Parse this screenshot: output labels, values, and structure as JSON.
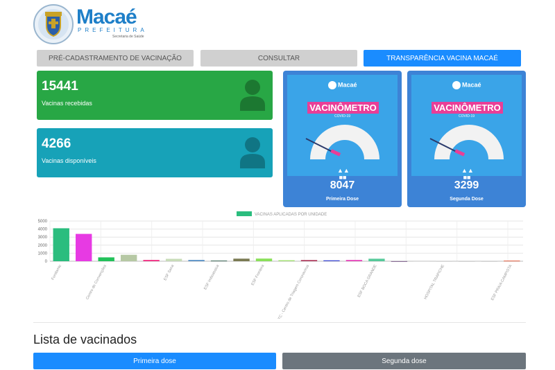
{
  "brand": {
    "name": "Macaé",
    "subtitle": "PREFEITURA",
    "department": "Secretaria de Saúde"
  },
  "tabs": [
    {
      "label": "PRÉ-CADASTRAMENTO DE VACINAÇÃO",
      "active": false
    },
    {
      "label": "CONSULTAR",
      "active": false
    },
    {
      "label": "TRANSPARÊNCIA VACINA MACAÉ",
      "active": true
    }
  ],
  "stats": [
    {
      "value": "15441",
      "label": "Vacinas recebidas",
      "color": "#28a745",
      "icon": "person-icon"
    },
    {
      "value": "4266",
      "label": "Vacinas disponíveis",
      "color": "#17a2b8",
      "icon": "person-icon"
    }
  ],
  "vaccinometers": [
    {
      "logo_text": "Macaé",
      "badge": "VACINÔMETRO",
      "sub": "COVID-19",
      "count": "8047",
      "dose": "Primeira Dose",
      "icon": "people-icon"
    },
    {
      "logo_text": "Macaé",
      "badge": "VACINÔMETRO",
      "sub": "COVID-19",
      "count": "3299",
      "dose": "Segunda Dose",
      "icon": "people-icon"
    }
  ],
  "chart_data": {
    "type": "bar",
    "legend": "VACINAS APLICADAS POR UNIDADE",
    "legend_position": "top-center",
    "grid": true,
    "ylim": [
      0,
      5000
    ],
    "yticks": [
      "0",
      "1000",
      "2000",
      "3000",
      "4000",
      "5000"
    ],
    "categories": [
      "Fundamic",
      "",
      "Centro de Convenções",
      "",
      "",
      "ESF Sana",
      "",
      "ESF Imboassica",
      "",
      "ESF Frontera",
      "",
      "CTC - Centro de Triagem Coronavírus",
      "",
      "",
      "ESF BOCA GRANDE",
      "",
      "",
      "HOSPITAL TRAPICHE",
      "",
      "",
      "ESF PRAIA CAMPISTA"
    ],
    "values": [
      4100,
      3400,
      480,
      800,
      150,
      300,
      150,
      80,
      320,
      330,
      120,
      140,
      110,
      150,
      310,
      10,
      60,
      20,
      10,
      10,
      70
    ],
    "colors": [
      "#2bbd7e",
      "#e73ae3",
      "#22c15a",
      "#b6c8a4",
      "#f0207a",
      "#c8dcb9",
      "#4f8ac2",
      "#3f6b58",
      "#7a7a52",
      "#8ae05a",
      "#a0e070",
      "#a82e52",
      "#3a46d2",
      "#e43ab6",
      "#56c99a",
      "#7c5c8a",
      "#cccccc",
      "#cccccc",
      "#cccccc",
      "#cccccc",
      "#e05a3a"
    ],
    "labeled_indices": [
      0,
      2,
      5,
      7,
      9,
      11,
      14,
      17,
      20
    ]
  },
  "list": {
    "title": "Lista de vacinados"
  },
  "buttons": [
    {
      "label": "Primeira dose",
      "color": "#1a8cff"
    },
    {
      "label": "Segunda dose",
      "color": "#6c757d"
    }
  ]
}
